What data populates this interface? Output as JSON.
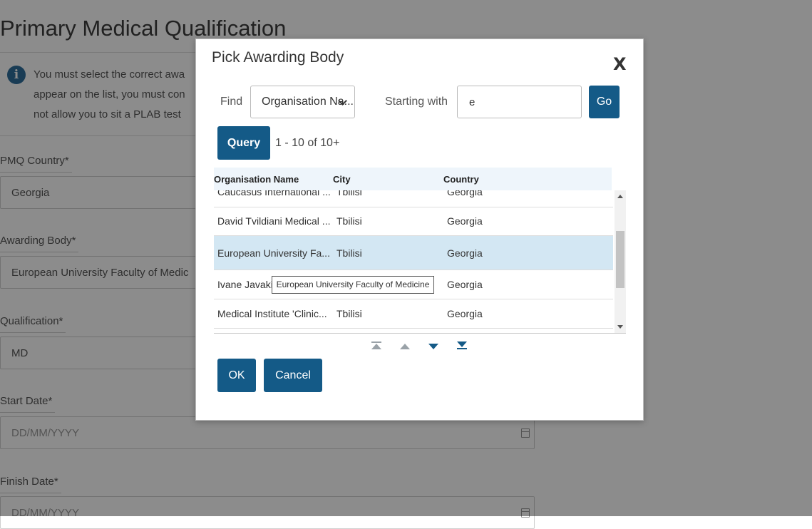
{
  "page": {
    "title": "Primary Medical Qualification",
    "info_lines": [
      "You must select the correct awa",
      "appear on the list, you must con",
      "not allow you to sit a PLAB test"
    ],
    "fields": [
      {
        "label": "PMQ Country*",
        "value": "Georgia"
      },
      {
        "label": "Awarding Body*",
        "value": "European University Faculty of Medic"
      },
      {
        "label": "Qualification*",
        "value": "MD"
      },
      {
        "label": "Start Date*",
        "placeholder": "DD/MM/YYYY"
      },
      {
        "label": "Finish Date*",
        "placeholder": "DD/MM/YYYY"
      }
    ]
  },
  "modal": {
    "title": "Pick Awarding Body",
    "close_label": "X",
    "find_label": "Find",
    "find_select_value": "Organisation Na...",
    "starting_with_label": "Starting with",
    "search_value": "e",
    "go_label": "Go",
    "query_label": "Query",
    "result_count": "1 - 10 of 10+",
    "columns": [
      "Organisation Name",
      "City",
      "Country"
    ],
    "rows": [
      {
        "name": "Caucasus International ...",
        "city": "Tbilisi",
        "country": "Georgia"
      },
      {
        "name": "David Tvildiani Medical ...",
        "city": "Tbilisi",
        "country": "Georgia"
      },
      {
        "name": "European University Fa...",
        "city": "Tbilisi",
        "country": "Georgia"
      },
      {
        "name": "Ivane Javaki",
        "city": "",
        "country": "Georgia"
      },
      {
        "name": "Medical Institute 'Clinic...",
        "city": "Tbilisi",
        "country": "Georgia"
      }
    ],
    "selected_row": 2,
    "tooltip": "European University Faculty of Medicine",
    "ok_label": "OK",
    "cancel_label": "Cancel"
  },
  "colors": {
    "primary": "#145a87",
    "selected_row": "#d3e7f3",
    "header_row": "#eef5fb"
  },
  "icons": [
    "info-icon",
    "close-icon",
    "chevron-down-icon",
    "calendar-icon",
    "first-page-icon",
    "previous-page-icon",
    "next-page-icon",
    "last-page-icon"
  ]
}
